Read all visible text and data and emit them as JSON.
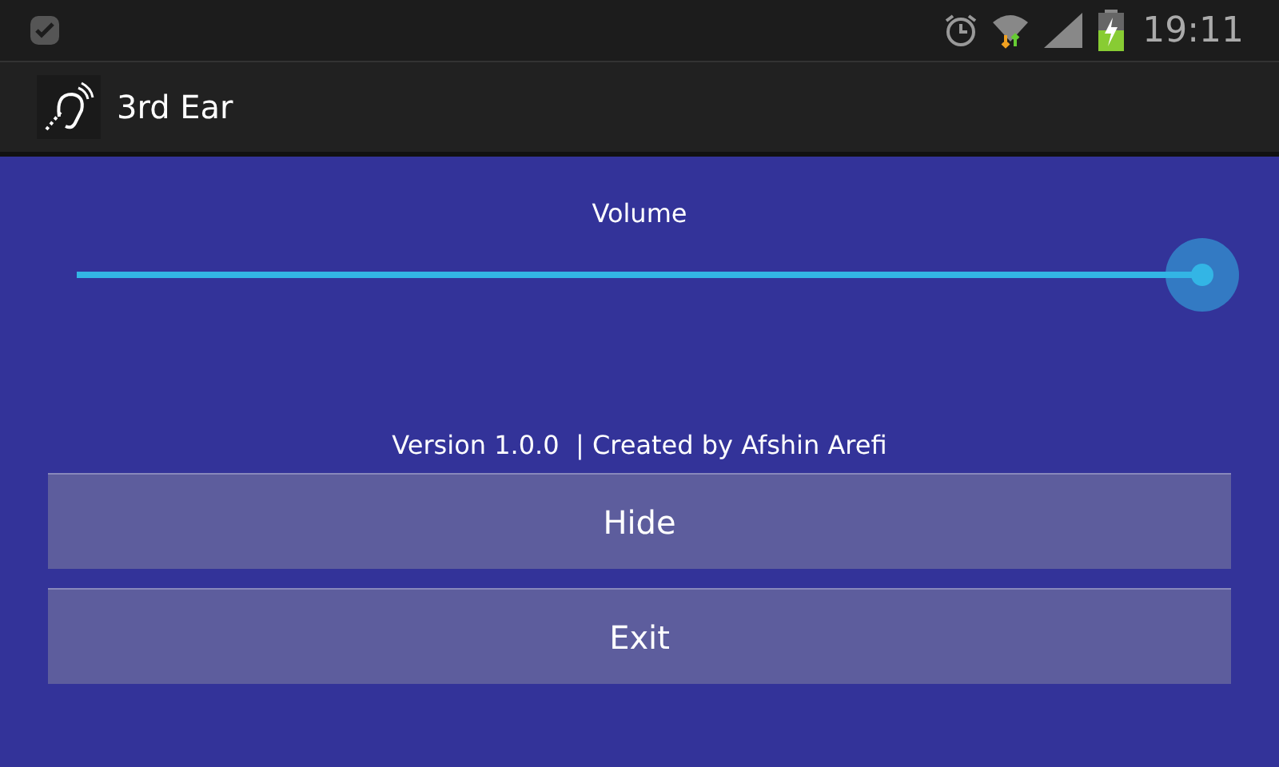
{
  "status_bar": {
    "time": "19:11"
  },
  "action_bar": {
    "title": "3rd Ear"
  },
  "volume": {
    "label": "Volume",
    "level": 1.0
  },
  "footer_text": "Version 1.0.0  | Created by Afshin Arefi",
  "buttons": [
    "Hide",
    "Exit"
  ]
}
